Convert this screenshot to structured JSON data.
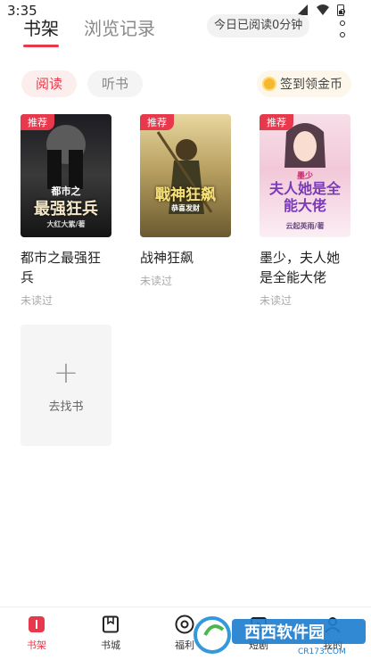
{
  "status_bar": {
    "time": "3:35"
  },
  "header": {
    "tabs": [
      {
        "label": "书架"
      },
      {
        "label": "浏览记录"
      }
    ],
    "read_time": "今日已阅读0分钟"
  },
  "subtabs": [
    {
      "label": "阅读"
    },
    {
      "label": "听书"
    }
  ],
  "checkin": {
    "label": "签到领金币"
  },
  "books": [
    {
      "badge": "推荐",
      "name": "都市之最强狂兵",
      "status": "未读过",
      "cover_text": "最强狂兵",
      "cover_sub": "都市之",
      "cover_author": "大红大紫/著"
    },
    {
      "badge": "推荐",
      "name": "战神狂飙",
      "status": "未读过",
      "cover_text": "戰神狂飙",
      "cover_author": "恭喜发财"
    },
    {
      "badge": "推荐",
      "name": "墨少，夫人她是全能大佬",
      "status": "未读过",
      "cover_text": "夫人她是全能大佬",
      "cover_sub": "墨少",
      "cover_author": "云起英雨/著"
    }
  ],
  "add_book": {
    "label": "去找书",
    "icon": "plus-icon"
  },
  "bottom_nav": [
    {
      "label": "书架",
      "icon": "bookshelf-icon"
    },
    {
      "label": "书城",
      "icon": "bookstore-icon"
    },
    {
      "label": "福利",
      "icon": "welfare-icon"
    },
    {
      "label": "短剧",
      "icon": "short-drama-icon"
    },
    {
      "label": "我的",
      "icon": "profile-icon"
    }
  ],
  "watermark": {
    "text": "西西软件园",
    "sub": "CR173.COM"
  },
  "colors": {
    "accent": "#e8384b",
    "coin": "#f5b731"
  }
}
